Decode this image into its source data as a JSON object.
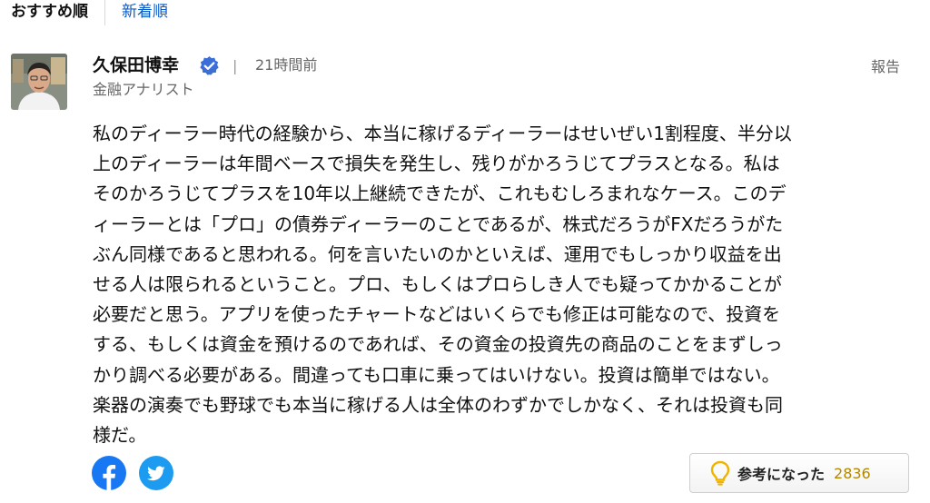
{
  "sort_tabs": {
    "recommended": "おすすめ順",
    "newest": "新着順"
  },
  "comment": {
    "author": "久保田博幸",
    "verified": true,
    "separator": "|",
    "time": "21時間前",
    "author_title": "金融アナリスト",
    "report_label": "報告",
    "body_lines": [
      "私のディーラー時代の経験から、本当に稼げるディーラーはせいぜい1割程度、半分以",
      "上のディーラーは年間ベースで損失を発生し、残りがかろうじてプラスとなる。私は",
      "そのかろうじてプラスを10年以上継続できたが、これもむしろまれなケース。このデ",
      "ィーラーとは「プロ」の債券ディーラーのことであるが、株式だろうがFXだろうがた",
      "ぶん同様であると思われる。何を言いたいのかといえば、運用でもしっかり収益を出",
      "せる人は限られるということ。プロ、もしくはプロらしき人でも疑ってかかることが",
      "必要だと思う。アプリを使ったチャートなどはいくらでも修正は可能なので、投資を",
      "する、もしくは資金を預けるのであれば、その資金の投資先の商品のことをまずしっ",
      "かり調べる必要がある。間違っても口車に乗ってはいけない。投資は簡単ではない。",
      "楽器の演奏でも野球でも本当に稼げる人は全体のわずかでしかなく、それは投資も同",
      "様だ。"
    ],
    "helpful_label": "参考になった",
    "helpful_count": "2836"
  },
  "icons": {
    "verified": "verified-badge-icon",
    "facebook": "facebook-icon",
    "twitter": "twitter-icon",
    "bulb": "lightbulb-icon"
  },
  "colors": {
    "link": "#0b5bc4",
    "verified": "#3a6fd8",
    "facebook": "#1877f2",
    "twitter": "#1d9bf0",
    "count": "#b38600"
  }
}
